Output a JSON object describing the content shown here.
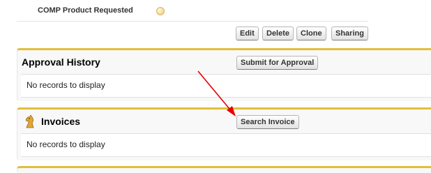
{
  "detail_field": {
    "label": "COMP Product Requested"
  },
  "record_buttons": {
    "edit": "Edit",
    "delete": "Delete",
    "clone": "Clone",
    "sharing": "Sharing"
  },
  "approval_history": {
    "title": "Approval History",
    "button": "Submit for Approval",
    "empty": "No records to display"
  },
  "invoices": {
    "title": "Invoices",
    "button": "Search Invoice",
    "empty": "No records to display",
    "icon": "chess-knight-icon"
  },
  "colors": {
    "section_border": "#e1be3a",
    "annotation_arrow": "#e60000"
  }
}
